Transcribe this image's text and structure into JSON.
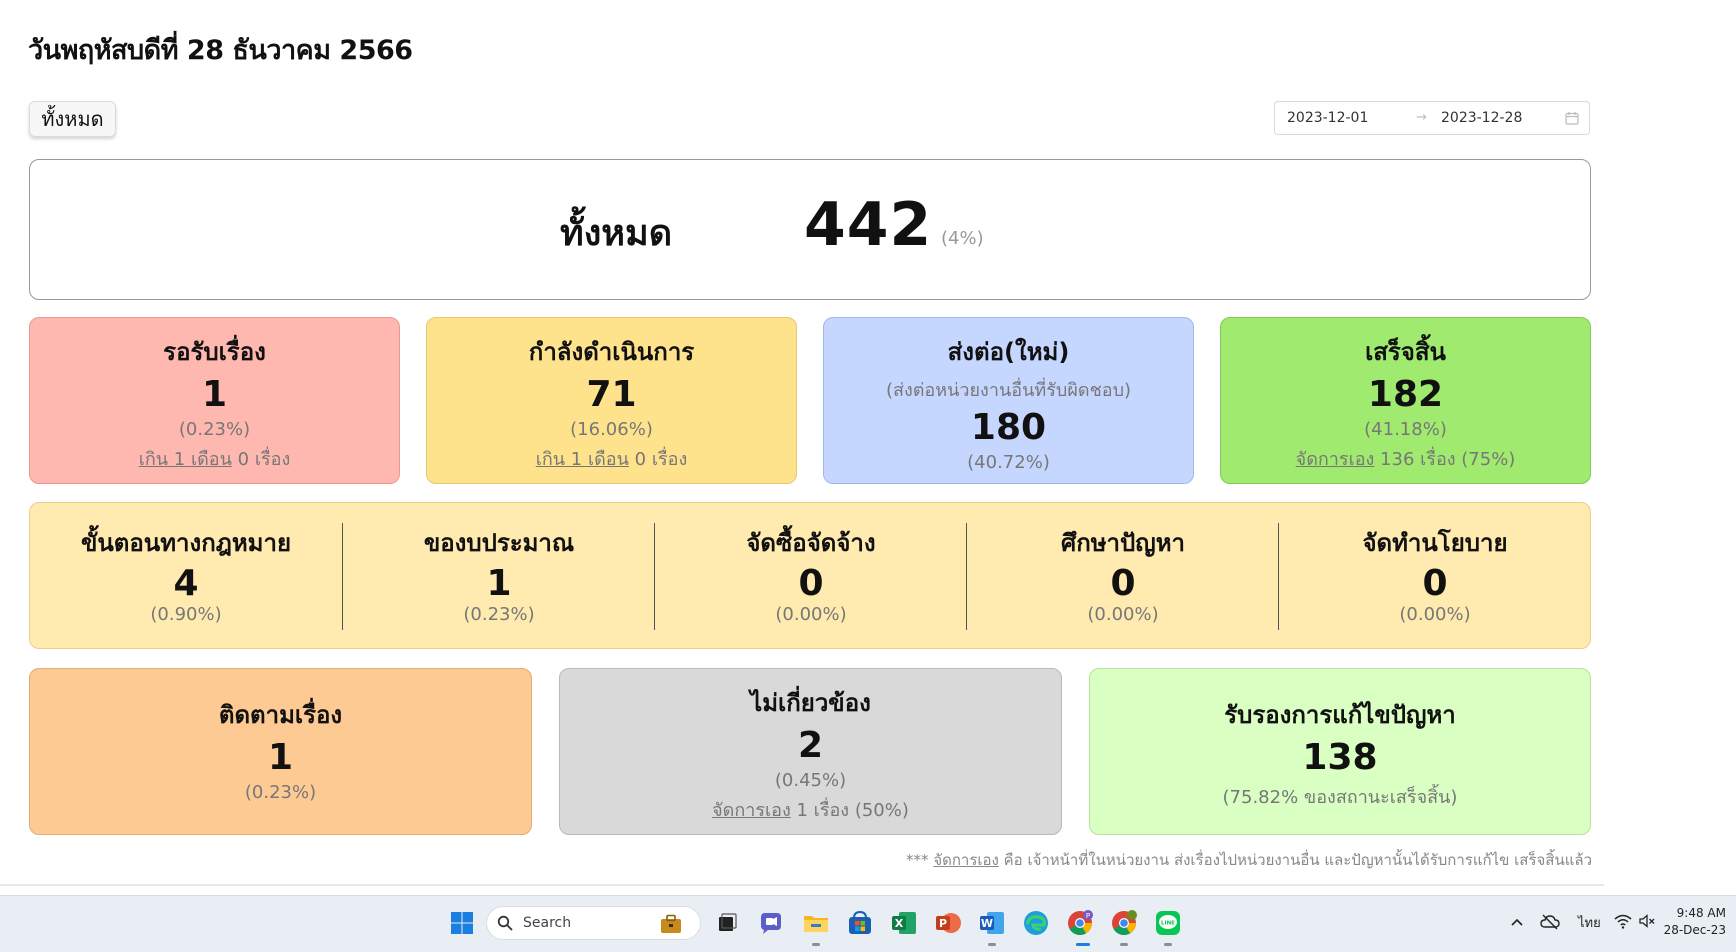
{
  "page_title": "วันพฤหัสบดีที่ 28 ธันวาคม 2566",
  "filter_button": "ทั้งหมด",
  "date_range": {
    "start": "2023-12-01",
    "separator": "→",
    "end": "2023-12-28"
  },
  "total": {
    "label": "ทั้งหมด",
    "value": "442",
    "pct": "(4%)"
  },
  "status_cards": {
    "pending": {
      "title": "รอรับเรื่อง",
      "value": "1",
      "pct": "(0.23%)",
      "link": "เกิน 1 เดือน",
      "tail": " 0 เรื่อง"
    },
    "progress": {
      "title": "กำลังดำเนินการ",
      "value": "71",
      "pct": "(16.06%)",
      "link": "เกิน 1 เดือน",
      "tail": " 0 เรื่อง"
    },
    "forward": {
      "title": "ส่งต่อ(ใหม่)",
      "subtitle": "(ส่งต่อหน่วยงานอื่นที่รับผิดชอบ)",
      "value": "180",
      "pct": "(40.72%)"
    },
    "done": {
      "title": "เสร็จสิ้น",
      "value": "182",
      "pct": "(41.18%)",
      "link": "จัดการเอง",
      "tail": " 136 เรื่อง (75%)"
    }
  },
  "sub_categories": [
    {
      "title": "ขั้นตอนทางกฎหมาย",
      "value": "4",
      "pct": "(0.90%)"
    },
    {
      "title": "ของบประมาณ",
      "value": "1",
      "pct": "(0.23%)"
    },
    {
      "title": "จัดซื้อจัดจ้าง",
      "value": "0",
      "pct": "(0.00%)"
    },
    {
      "title": "ศึกษาปัญหา",
      "value": "0",
      "pct": "(0.00%)"
    },
    {
      "title": "จัดทำนโยบาย",
      "value": "0",
      "pct": "(0.00%)"
    }
  ],
  "bottom_cards": {
    "follow": {
      "title": "ติดตามเรื่อง",
      "value": "1",
      "pct": "(0.23%)"
    },
    "unrelated": {
      "title": "ไม่เกี่ยวข้อง",
      "value": "2",
      "pct": "(0.45%)",
      "link": "จัดการเอง",
      "tail": " 1 เรื่อง (50%)"
    },
    "resolved": {
      "title": "รับรองการแก้ไขปัญหา",
      "value": "138",
      "note": "(75.82% ของสถานะเสร็จสิ้น)"
    }
  },
  "footnote": {
    "prefix": "*** ",
    "link": "จัดการเอง",
    "text": " คือ เจ้าหน้าที่ในหน่วยงาน ส่งเรื่องไปหน่วยงานอื่น และปัญหานั้นได้รับการแก้ไข เสร็จสิ้นแล้ว"
  },
  "taskbar": {
    "search_label": "Search",
    "language": "ไทย",
    "time": "9:48 AM",
    "date": "28-Dec-23",
    "icons": [
      "windows-start-icon",
      "work-briefcase-icon",
      "task-view-icon",
      "teams-chat-icon",
      "file-explorer-icon",
      "store-icon",
      "excel-icon",
      "powerpoint-icon",
      "word-icon",
      "edge-icon",
      "chrome-icon",
      "chrome-profile-icon",
      "line-icon"
    ]
  },
  "colors": {
    "pending": "#ffb8b0",
    "progress": "#ffe38c",
    "forward": "#c5d6ff",
    "done": "#a0ea70",
    "sub_panel": "#ffeab0",
    "follow": "#fdca94",
    "unrelated": "#d9d9d9",
    "resolved": "#daffc3"
  }
}
